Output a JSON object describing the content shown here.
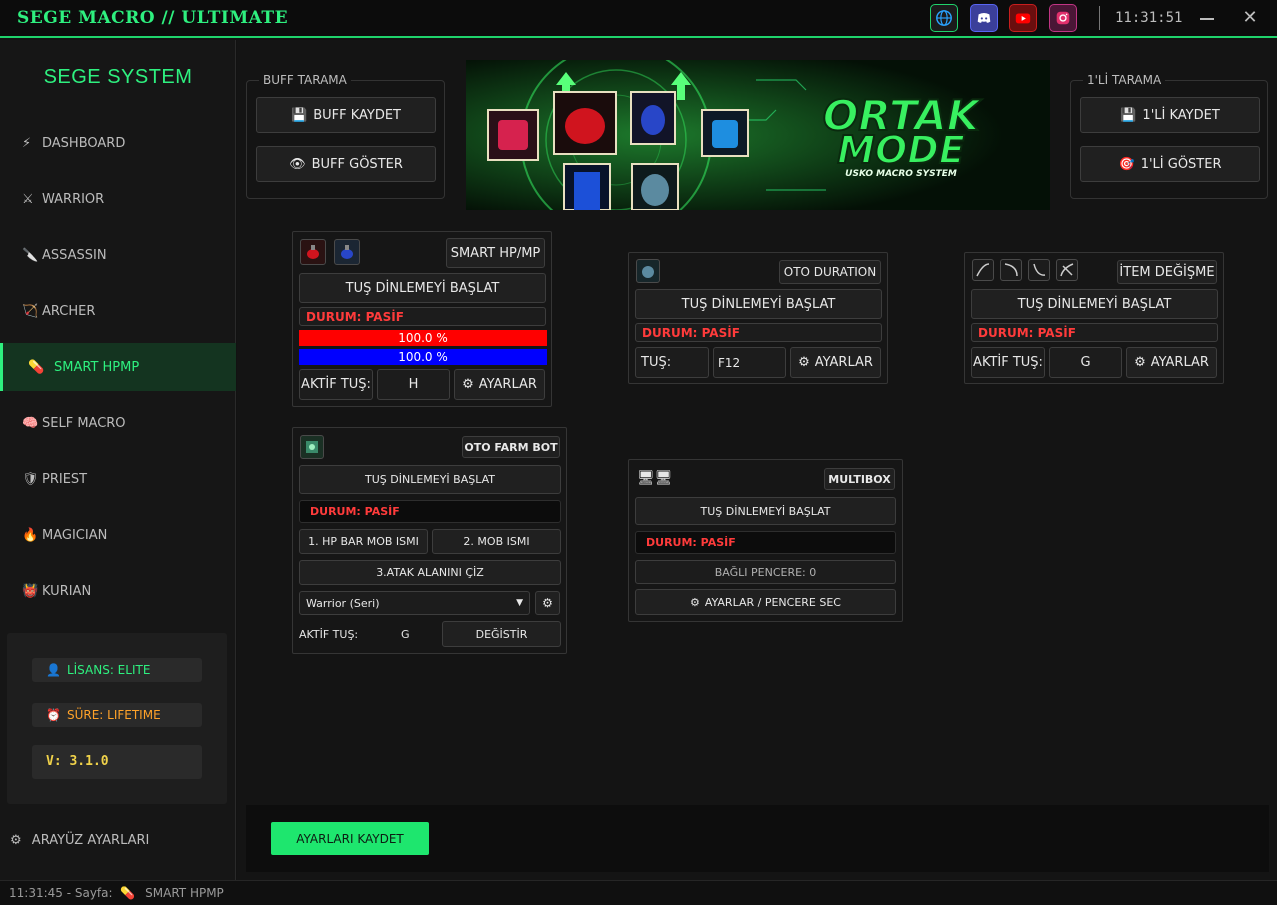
{
  "window": {
    "title": "SEGE MACRO // ULTIMATE",
    "clock": "11:31:51",
    "close_glyph": "✕"
  },
  "social": [
    {
      "name": "web-icon",
      "color": "#1fd36b"
    },
    {
      "name": "discord-icon",
      "color": "#5865f2"
    },
    {
      "name": "youtube-icon",
      "color": "#ff0000"
    },
    {
      "name": "instagram-icon",
      "color": "#e1306c"
    }
  ],
  "sidebar": {
    "brand": "SEGE SYSTEM",
    "items": [
      {
        "label": "DASHBOARD",
        "icon": "⚡"
      },
      {
        "label": "WARRIOR",
        "icon": "⚔"
      },
      {
        "label": "ASSASSIN",
        "icon": "🔪"
      },
      {
        "label": "ARCHER",
        "icon": "🏹"
      },
      {
        "label": "SMART HPMP",
        "icon": "💊"
      },
      {
        "label": "SELF MACRO",
        "icon": "🧠"
      },
      {
        "label": "PRIEST",
        "icon": "🛡"
      },
      {
        "label": "MAGICIAN",
        "icon": "🔥"
      },
      {
        "label": "KURIAN",
        "icon": "👹"
      }
    ],
    "active_index": 4,
    "license": "LİSANS: ELITE",
    "license_icon": "👤",
    "duration": "SÜRE: LIFETIME",
    "duration_icon": "⏰",
    "version": "V: 3.1.0",
    "ui_settings": "ARAYÜZ AYARLARI",
    "ui_settings_icon": "⚙"
  },
  "buff_group": {
    "title": "BUFF TARAMA",
    "save": "BUFF KAYDET",
    "save_icon": "💾",
    "show": "BUFF GÖSTER",
    "show_icon": "👁"
  },
  "single_group": {
    "title": "1'Lİ TARAMA",
    "save": "1'Lİ KAYDET",
    "save_icon": "💾",
    "show": "1'Lİ GÖSTER",
    "show_icon": "🎯"
  },
  "banner": {
    "line1": "ORTAK",
    "line2": "MODE",
    "sub": "USKO MACRO SYSTEM"
  },
  "smart_hp": {
    "title": "SMART HP/MP",
    "listen": "TUŞ DİNLEMEYİ BAŞLAT",
    "status": "DURUM: PASİF",
    "hp_text": "100.0 %",
    "mp_text": "100.0 %",
    "hp_percent": 100,
    "mp_percent": 100,
    "key_label": "AKTİF TUŞ:",
    "key": "H",
    "settings": "AYARLAR",
    "settings_icon": "⚙"
  },
  "oto_duration": {
    "title": "OTO DURATION",
    "listen": "TUŞ DİNLEMEYİ BAŞLAT",
    "status": "DURUM: PASİF",
    "key_label": "TUŞ:",
    "key": "F12",
    "settings": "AYARLAR",
    "settings_icon": "⚙"
  },
  "item_swap": {
    "title": "İTEM DEĞİŞME",
    "listen": "TUŞ DİNLEMEYİ BAŞLAT",
    "status": "DURUM: PASİF",
    "key_label": "AKTİF TUŞ:",
    "key": "G",
    "settings": "AYARLAR",
    "settings_icon": "⚙"
  },
  "farm_bot": {
    "title": "OTO FARM BOT",
    "listen": "TUŞ DİNLEMEYİ BAŞLAT",
    "status": "DURUM: PASİF",
    "mob1": "1. HP BAR MOB ISMI",
    "mob2": "2. MOB ISMI",
    "attack_area": "3.ATAK ALANINI ÇİZ",
    "class_select": "Warrior (Seri)",
    "key_label": "AKTİF TUŞ:",
    "key": "G",
    "change": "DEĞİSTİR",
    "gear_icon": "⚙"
  },
  "multibox": {
    "title": "MULTIBOX",
    "listen": "TUŞ DİNLEMEYİ BAŞLAT",
    "status": "DURUM: PASİF",
    "connected": "BAĞLI PENCERE: 0",
    "settings": "AYARLAR / PENCERE SEC",
    "settings_icon": "⚙",
    "monitor_icon": "🖥"
  },
  "footer": {
    "save": "AYARLARI KAYDET"
  },
  "statusbar": {
    "text": "11:31:45 - Sayfa:",
    "icon": "💊",
    "page": "SMART HPMP"
  },
  "colors": {
    "accent": "#2ef07f",
    "status_red": "#ff3b3b",
    "hp_bar": "#ff0000",
    "mp_bar": "#0000ff",
    "version": "#f0d24a",
    "duration": "#ffa229"
  }
}
